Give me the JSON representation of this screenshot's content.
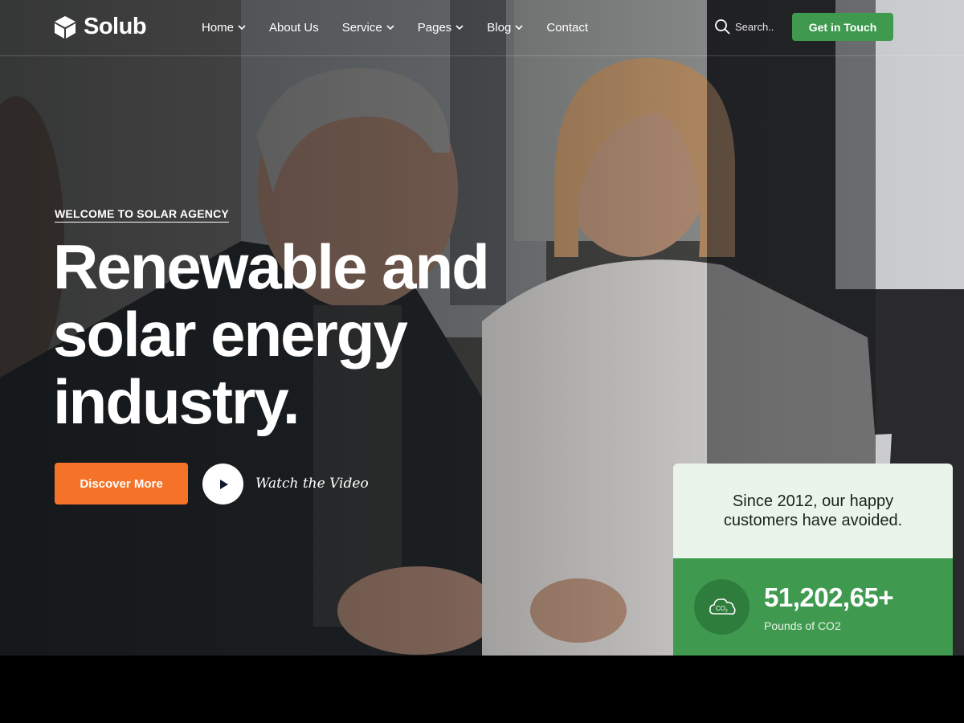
{
  "brand": {
    "name": "Solub"
  },
  "nav": {
    "items": [
      {
        "label": "Home",
        "has_dropdown": true
      },
      {
        "label": "About Us",
        "has_dropdown": false
      },
      {
        "label": "Service",
        "has_dropdown": true
      },
      {
        "label": "Pages",
        "has_dropdown": true
      },
      {
        "label": "Blog",
        "has_dropdown": true
      },
      {
        "label": "Contact",
        "has_dropdown": false
      }
    ]
  },
  "search": {
    "placeholder": "Search..",
    "icon": "search-icon"
  },
  "header_cta": {
    "label": "Get in Touch",
    "color": "#3f9a4f"
  },
  "hero": {
    "eyebrow": "WELCOME TO SOLAR AGENCY",
    "headline": "Renewable and solar energy industry.",
    "primary_button": {
      "label": "Discover More",
      "color": "#f57328"
    },
    "video_link": {
      "label": "Watch the Video",
      "icon": "play-icon"
    }
  },
  "stats": {
    "intro": "Since 2012, our happy customers have avoided.",
    "value": "51,202,65+",
    "label": "Pounds of CO2",
    "icon": "co2-cloud-icon",
    "accent": "#3f9a4f"
  }
}
